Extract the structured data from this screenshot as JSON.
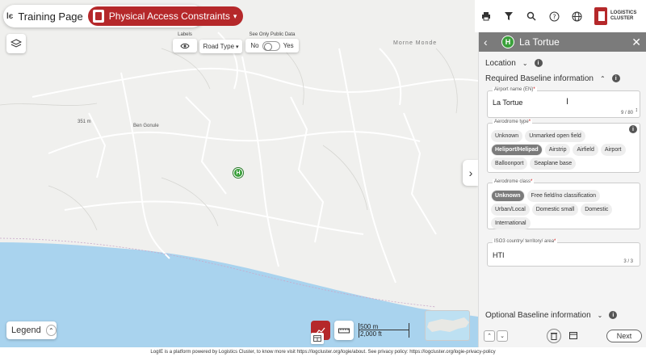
{
  "app": {
    "title": "Training Page",
    "logo_text": "lє",
    "theme": "Physical Access Constraints"
  },
  "map_controls": {
    "labels_caption": "Labels",
    "road_type_label": "Road Type",
    "public_caption": "See Only Public Data",
    "public_no": "No",
    "public_yes": "Yes"
  },
  "map": {
    "place_labels": [
      "351 m",
      "Ben Gonule",
      "Morne Monde"
    ],
    "legend_label": "Legend",
    "scale_metric": "500 m",
    "scale_imperial": "2,000 ft"
  },
  "header_icons": [
    "print-icon",
    "filter-icon",
    "search-icon",
    "help-icon",
    "globe-icon"
  ],
  "brand": {
    "line1": "LOGISTICS",
    "line2": "CLUSTER"
  },
  "panel": {
    "title": "La Tortue",
    "location_label": "Location",
    "required_label": "Required Baseline information",
    "airport_name": {
      "label": "Airport name (EN)",
      "value": "La Tortue",
      "count": "9 / 80"
    },
    "aerodrome_type": {
      "label": "Aerodrome type",
      "options": [
        "Unknown",
        "Unmarked open field",
        "Heliport/Helipad",
        "Airstrip",
        "Airfield",
        "Airport",
        "Balloonport",
        "Seaplane base"
      ],
      "selected": "Heliport/Helipad"
    },
    "aerodrome_class": {
      "label": "Aerodrome class",
      "options": [
        "Unknown",
        "Free field/no classification",
        "Urban/Local",
        "Domestic small",
        "Domestic",
        "International"
      ],
      "selected": "Unknown"
    },
    "iso3": {
      "label": "ISO3 country/ territory/ area",
      "value": "HTI",
      "count": "3 / 3"
    },
    "optional_label": "Optional Baseline information",
    "next_label": "Next"
  },
  "footer": {
    "text": "LogIE is a platform powered by Logistics Cluster, to know more visit https://logcluster.org/logie/about. See privacy policy: https://logcluster.org/logie-privacy-policy"
  }
}
